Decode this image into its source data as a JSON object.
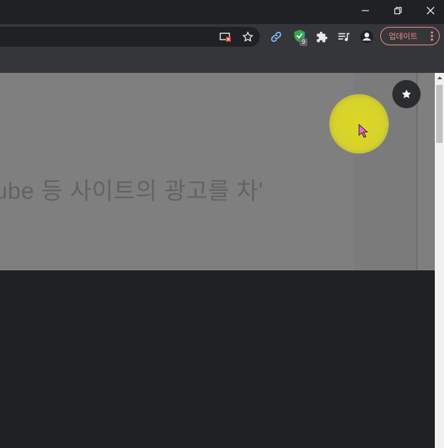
{
  "window": {
    "minimize_icon": "minimize-icon",
    "restore_icon": "restore-icon",
    "close_icon": "close-icon"
  },
  "toolbar": {
    "update_label": "업데이트",
    "extension_badge": "9",
    "icons": [
      "camera-off-icon",
      "star-icon",
      "link-icon",
      "shield-icon",
      "puzzle-icon",
      "queue-music-icon",
      "profile-icon",
      "more-vert-icon"
    ]
  },
  "video": {
    "caption": "ube 등 사이트의 광고를 차'",
    "background_color": "#7f7f7f",
    "highlight_color": "#d6d22a"
  },
  "colors": {
    "accent_update": "#f28b82",
    "shield": "#34a853",
    "link": "#8ab4f8"
  }
}
